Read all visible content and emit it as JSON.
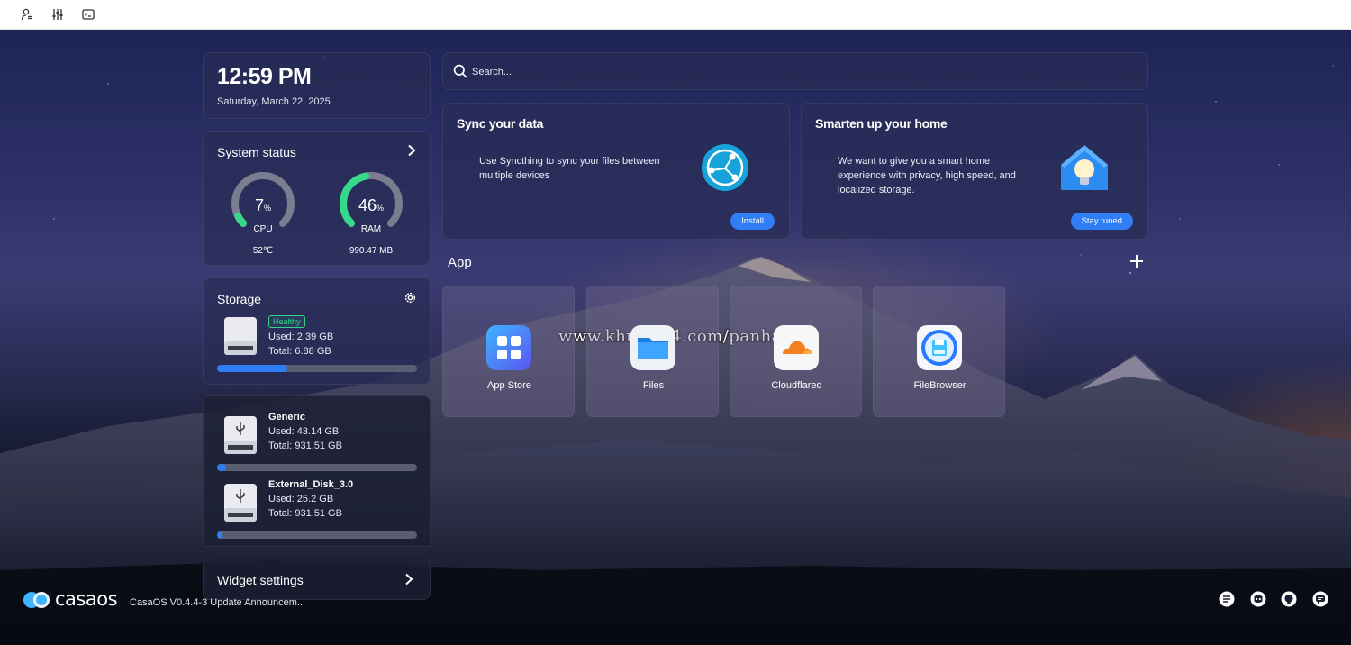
{
  "topbar": {
    "icons": [
      "user-settings-icon",
      "sliders-icon",
      "terminal-icon"
    ]
  },
  "clock": {
    "time": "12:59 PM",
    "date": "Saturday, March 22, 2025"
  },
  "system_status": {
    "title": "System status",
    "cpu": {
      "value": "7",
      "unit": "%",
      "label": "CPU",
      "temp": "52℃",
      "percent": 7
    },
    "ram": {
      "value": "46",
      "unit": "%",
      "label": "RAM",
      "used": "990.47 MB",
      "percent": 46
    },
    "colors": {
      "gauge_fill": "#36d98c",
      "gauge_track": "#7a7c90"
    }
  },
  "storage": {
    "title": "Storage",
    "status": "Healthy",
    "used": "Used: 2.39 GB",
    "total": "Total: 6.88 GB",
    "percent": 35
  },
  "drives": [
    {
      "name": "Generic",
      "used": "Used: 43.14 GB",
      "total": "Total: 931.51 GB",
      "percent": 4.6
    },
    {
      "name": "External_Disk_3.0",
      "used": "Used: 25.2 GB",
      "total": "Total: 931.51 GB",
      "percent": 2.7
    }
  ],
  "widget_settings": {
    "label": "Widget settings"
  },
  "search": {
    "placeholder": "Search..."
  },
  "promos": [
    {
      "title": "Sync your data",
      "description": "Use Syncthing to sync your files between multiple devices",
      "button": "Install"
    },
    {
      "title": "Smarten up your home",
      "description": "We want to give you a smart home experience with privacy, high speed, and localized storage.",
      "button": "Stay tuned"
    }
  ],
  "apps": {
    "title": "App",
    "items": [
      {
        "name": "App Store",
        "icon": "app-store-icon"
      },
      {
        "name": "Files",
        "icon": "files-icon"
      },
      {
        "name": "Cloudflared",
        "icon": "cloudflared-icon"
      },
      {
        "name": "FileBrowser",
        "icon": "filebrowser-icon"
      }
    ]
  },
  "watermark": "www.khmer24.com/panha.p",
  "footer": {
    "logo": "casaos",
    "announcement": "CasaOS V0.4.4-3 Update Announcem...",
    "social_icons": [
      "feedback-icon",
      "discord-icon",
      "github-icon",
      "chat-icon"
    ]
  },
  "colors": {
    "accent": "#2f7ef5",
    "healthy": "#33d48a"
  }
}
